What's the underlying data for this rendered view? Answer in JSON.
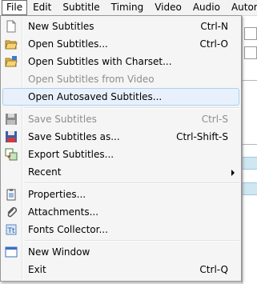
{
  "menubar": {
    "items": [
      "File",
      "Edit",
      "Subtitle",
      "Timing",
      "Video",
      "Audio",
      "Automation"
    ]
  },
  "file_menu": {
    "items": [
      {
        "label": "New Subtitles",
        "shortcut": "Ctrl-N",
        "icon": "new-document-icon",
        "enabled": true
      },
      {
        "label": "Open Subtitles...",
        "shortcut": "Ctrl-O",
        "icon": "open-folder-icon",
        "enabled": true
      },
      {
        "label": "Open Subtitles with Charset...",
        "shortcut": "",
        "icon": "open-folder-charset-icon",
        "enabled": true
      },
      {
        "label": "Open Subtitles from Video",
        "shortcut": "",
        "icon": "",
        "enabled": false
      },
      {
        "label": "Open Autosaved Subtitles...",
        "shortcut": "",
        "icon": "",
        "enabled": true,
        "highlighted": true
      },
      {
        "label": "Save Subtitles",
        "shortcut": "Ctrl-S",
        "icon": "save-disk-icon",
        "enabled": false
      },
      {
        "label": "Save Subtitles as...",
        "shortcut": "Ctrl-Shift-S",
        "icon": "save-as-disk-icon",
        "enabled": true
      },
      {
        "label": "Export Subtitles...",
        "shortcut": "",
        "icon": "export-icon",
        "enabled": true
      },
      {
        "label": "Recent",
        "shortcut": "",
        "icon": "",
        "enabled": true,
        "submenu": true
      },
      {
        "label": "Properties...",
        "shortcut": "",
        "icon": "properties-clipboard-icon",
        "enabled": true
      },
      {
        "label": "Attachments...",
        "shortcut": "",
        "icon": "paperclip-icon",
        "enabled": true
      },
      {
        "label": "Fonts Collector...",
        "shortcut": "",
        "icon": "fonts-collector-icon",
        "enabled": true
      },
      {
        "label": "New Window",
        "shortcut": "",
        "icon": "window-icon",
        "enabled": true
      },
      {
        "label": "Exit",
        "shortcut": "Ctrl-Q",
        "icon": "",
        "enabled": true
      }
    ]
  },
  "colors": {
    "highlight_bg": "#e8f1fb",
    "highlight_border": "#a8d1f5",
    "disabled_text": "#8d8d8d"
  }
}
